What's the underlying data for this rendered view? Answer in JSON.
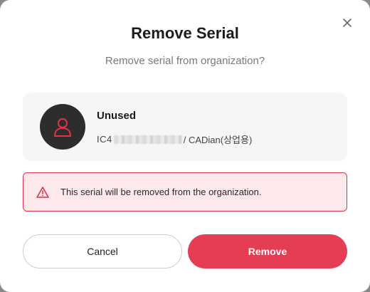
{
  "dialog": {
    "title": "Remove Serial",
    "subtitle": "Remove serial from organization?",
    "close_icon": "close-icon"
  },
  "serial_card": {
    "status": "Unused",
    "serial_prefix": "IC4",
    "product": "/ CADian(상업용)",
    "avatar_icon": "user-icon"
  },
  "warning": {
    "icon": "warning-triangle-icon",
    "message": "This serial will be removed from the organization.",
    "color": "#e0324b"
  },
  "actions": {
    "cancel_label": "Cancel",
    "remove_label": "Remove",
    "remove_color": "#e53e54"
  }
}
